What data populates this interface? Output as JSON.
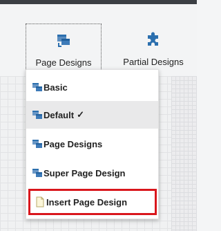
{
  "toolbar": {
    "page_designs_label": "Page Designs",
    "partial_designs_label": "Partial Designs"
  },
  "menu": {
    "items": [
      {
        "label": "Basic",
        "icon": "page-design-icon",
        "selected": false,
        "check": ""
      },
      {
        "label": "Default",
        "icon": "page-design-icon",
        "selected": true,
        "check": "✓"
      },
      {
        "label": "Page Designs",
        "icon": "page-design-icon",
        "selected": false,
        "check": ""
      },
      {
        "label": "Super Page Design",
        "icon": "page-design-icon",
        "selected": false,
        "check": ""
      },
      {
        "label": "Insert Page Design",
        "icon": "blank-page-icon",
        "selected": false,
        "check": "",
        "highlighted": true
      }
    ]
  },
  "colors": {
    "accent_blue": "#2b6fae",
    "highlight_red": "#d9161c",
    "topbar": "#3b3f44"
  }
}
